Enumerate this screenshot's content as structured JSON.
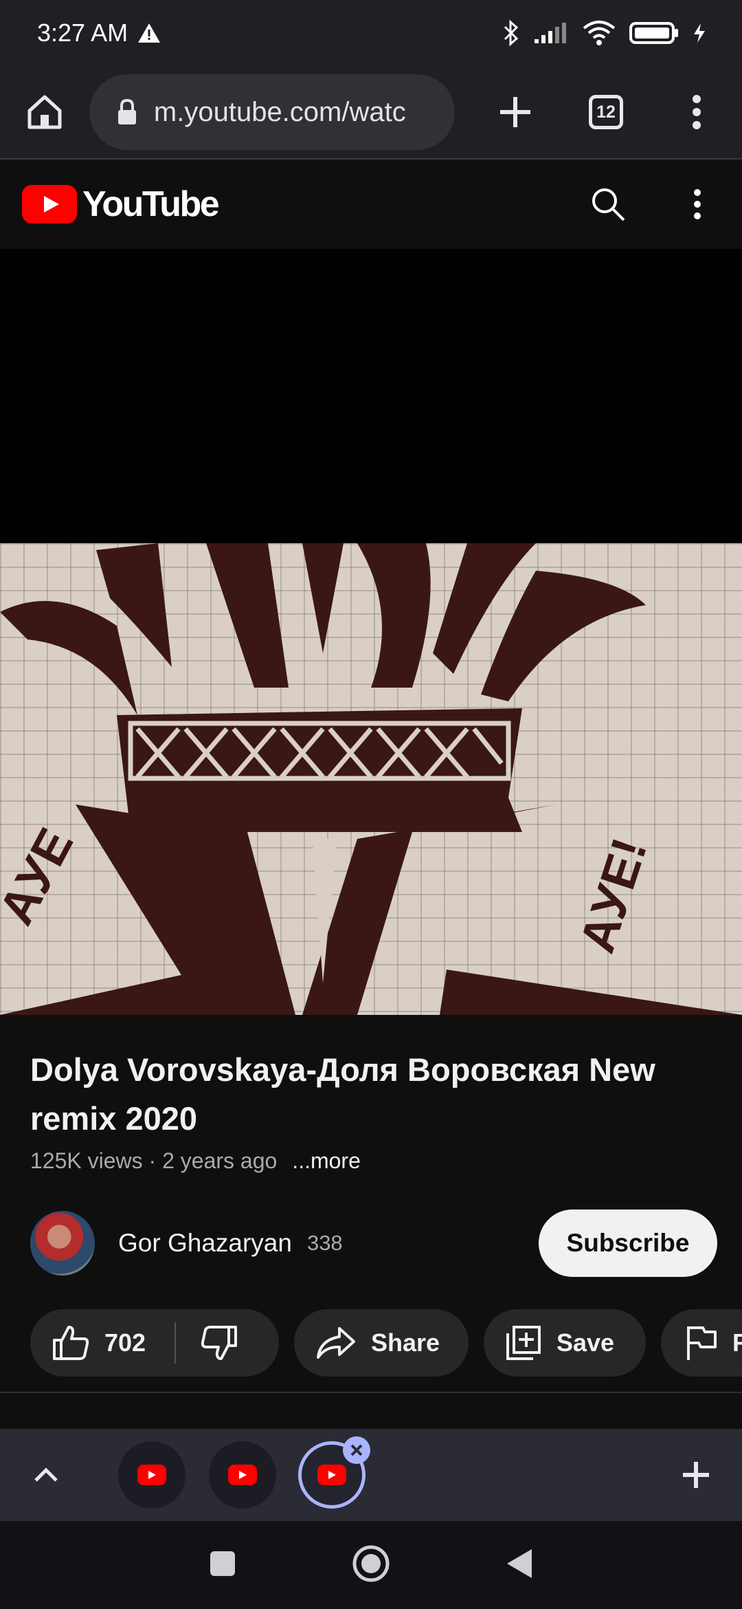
{
  "status_bar": {
    "time": "3:27 AM",
    "icons": [
      "warning-icon",
      "bluetooth-icon",
      "signal-icon",
      "wifi-icon",
      "battery-icon",
      "charging-icon"
    ]
  },
  "browser": {
    "url": "m.youtube.com/watc",
    "tab_count": "12",
    "icons": [
      "home-icon",
      "lock-icon",
      "new-tab-icon",
      "tab-switcher-icon",
      "menu-icon"
    ]
  },
  "youtube_header": {
    "wordmark": "YouTube",
    "icons": [
      "youtube-logo-icon",
      "search-icon",
      "more-icon"
    ]
  },
  "video": {
    "title": "Dolya Vorovskaya-Доля Воровская New remix 2020",
    "views_age": "125K views · 2 years ago",
    "more_label": "...more",
    "thumbnail_text_left": "AУЕ",
    "thumbnail_text_right": "AУЕ!"
  },
  "channel": {
    "name": "Gor Ghazaryan",
    "subscribers": "338",
    "subscribe_label": "Subscribe"
  },
  "actions": {
    "like_count": "702",
    "share_label": "Share",
    "save_label": "Save",
    "report_label": "R"
  },
  "colors": {
    "accent": "#a9b4ff",
    "youtube_red": "#ff0000",
    "background": "#0f0f0f"
  }
}
